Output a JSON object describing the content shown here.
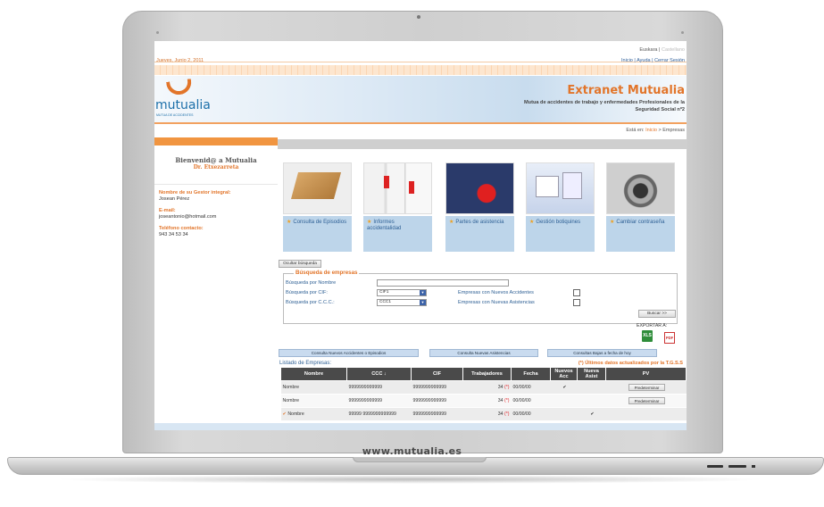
{
  "bezel_text": "www.mutualia.es",
  "header": {
    "lang_active": "Euskara",
    "lang_other": "Castellano",
    "date": "Jueves, Junio 2, 2011",
    "links": [
      "Inicio",
      "Ayuda",
      "Cerrar Sesión"
    ]
  },
  "banner": {
    "logo": "mutualia",
    "logo_sub": "MUTUA DE ACCIDENTES",
    "title": "Extranet Mutualia",
    "subtitle": "Mutua de accidentes de trabajo y enfermedades Profesionales de la Seguridad Social nº2"
  },
  "breadcrumb": {
    "prefix": "Está en:",
    "home": "Inicio",
    "current": "Empresas"
  },
  "sidebar": {
    "welcome": "Bienvenid@ a Mutualia",
    "user": "Dr. Etxezarreta",
    "gestor_label": "Nombre de su Gestor integral:",
    "gestor_value": "Josean Pérez",
    "email_label": "E-mail:",
    "email_value": "joseantonio@hotmail.com",
    "phone_label": "Teléfono contacto:",
    "phone_value": "943 34 53 34"
  },
  "tiles": [
    {
      "label": "Consulta de Episodios",
      "icon": "box-photo"
    },
    {
      "label": "Informes accidentalidad",
      "icon": "office-photo"
    },
    {
      "label": "Partes de asistencia",
      "icon": "hand-photo"
    },
    {
      "label": "Gestión botiquines",
      "icon": "first-aid-photo"
    },
    {
      "label": "Cambiar contraseña",
      "icon": "lock-photo"
    }
  ],
  "search": {
    "toggle": "Ocultar búsqueda",
    "legend": "Búsqueda de empresas",
    "by_name": "Búsqueda por Nombre",
    "by_cif": "Búsqueda por CIF:",
    "cif_value": "CIF1",
    "by_ccc": "Búsqueda por C.C.C.:",
    "ccc_value": "CCC1",
    "new_accidents": "Empresas con Nuevos Accidentes",
    "new_assist": "Empresas con Nuevas Asistencias",
    "button": "Buscar >>",
    "export": "EXPORTAR A:",
    "xls": "XLS",
    "pdf": "PDF"
  },
  "quick": [
    "Consulta Nuevos Accidentes o Episodios",
    "Consulta Nuevas Asistencias",
    "Consultas Bajas a fecha de hoy"
  ],
  "list": {
    "label": "Listado de Empresas:",
    "note": "(*) Últimos datos actualizados por la T.G.S.S",
    "headers": [
      "Nombre",
      "CCC ↓",
      "CIF",
      "Trabajadores",
      "Fecha",
      "Nuevos Acc",
      "Nueva Asist",
      "PV"
    ],
    "rows": [
      {
        "check": "",
        "name": "Nombre",
        "ccc": "9999999999999",
        "cif": "9999999999999",
        "workers": "34",
        "stars": "(*)",
        "date": "00/00/00",
        "acc": "✔",
        "asist": "",
        "pv": "Predeterminar"
      },
      {
        "check": "",
        "name": "Nombre",
        "ccc": "9999999999999",
        "cif": "9999999999999",
        "workers": "34",
        "stars": "(*)",
        "date": "00/00/00",
        "acc": "",
        "asist": "",
        "pv": "Predeterminar"
      },
      {
        "check": "✔",
        "name": "Nombre",
        "ccc": "99999 9999999999999",
        "cif": "9999999999999",
        "workers": "34",
        "stars": "(*)",
        "date": "00/00/00",
        "acc": "",
        "asist": "✔",
        "pv": ""
      }
    ]
  }
}
